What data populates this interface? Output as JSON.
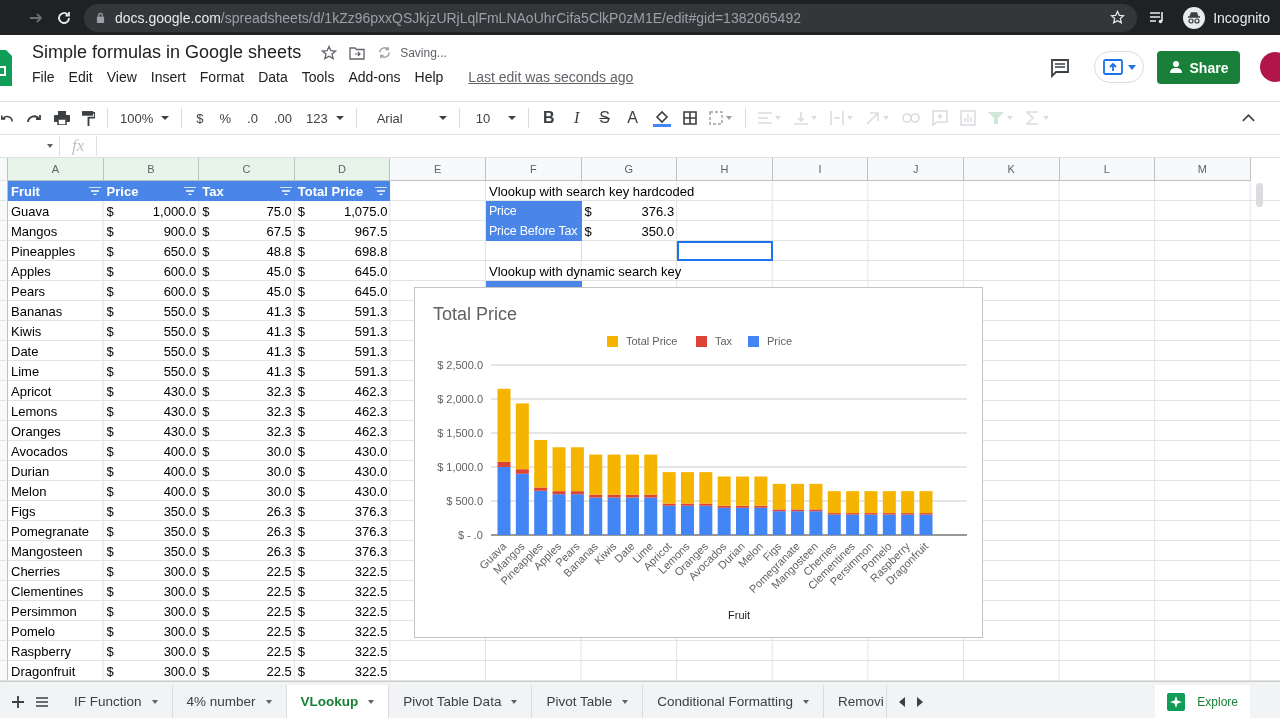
{
  "browser": {
    "url_host": "docs.google.com",
    "url_path": "/spreadsheets/d/1kZz96pxxQSJkjzURjLqlFmLNAoUhrCifa5ClkP0zM1E/edit#gid=1382065492",
    "profile": "Incognito"
  },
  "document": {
    "title": "Simple formulas in Google sheets",
    "status": "Saving...",
    "menu": [
      "File",
      "Edit",
      "View",
      "Insert",
      "Format",
      "Data",
      "Tools",
      "Add-ons",
      "Help"
    ],
    "last_edit": "Last edit was seconds ago",
    "share": "Share"
  },
  "toolbar": {
    "zoom": "100%",
    "currency": "$",
    "percent": "%",
    "decrease_decimals": ".0",
    "increase_decimals": ".00",
    "more_formats": "123",
    "font": "Arial",
    "font_size": "10",
    "text_styles": [
      "B",
      "I",
      "S",
      "A"
    ]
  },
  "formula_bar": {
    "label": "fx"
  },
  "columns": [
    "A",
    "B",
    "C",
    "D",
    "E",
    "F",
    "G",
    "H",
    "I",
    "J",
    "K",
    "L",
    "M"
  ],
  "table": {
    "headers": [
      "Fruit",
      "Price",
      "Tax",
      "Total Price"
    ],
    "rows": [
      [
        "Guava",
        [
          "$",
          "1,000.0"
        ],
        [
          "$",
          "75.0"
        ],
        [
          "$",
          "1,075.0"
        ]
      ],
      [
        "Mangos",
        [
          "$",
          "900.0"
        ],
        [
          "$",
          "67.5"
        ],
        [
          "$",
          "967.5"
        ]
      ],
      [
        "Pineapples",
        [
          "$",
          "650.0"
        ],
        [
          "$",
          "48.8"
        ],
        [
          "$",
          "698.8"
        ]
      ],
      [
        "Apples",
        [
          "$",
          "600.0"
        ],
        [
          "$",
          "45.0"
        ],
        [
          "$",
          "645.0"
        ]
      ],
      [
        "Pears",
        [
          "$",
          "600.0"
        ],
        [
          "$",
          "45.0"
        ],
        [
          "$",
          "645.0"
        ]
      ],
      [
        "Bananas",
        [
          "$",
          "550.0"
        ],
        [
          "$",
          "41.3"
        ],
        [
          "$",
          "591.3"
        ]
      ],
      [
        "Kiwis",
        [
          "$",
          "550.0"
        ],
        [
          "$",
          "41.3"
        ],
        [
          "$",
          "591.3"
        ]
      ],
      [
        "Date",
        [
          "$",
          "550.0"
        ],
        [
          "$",
          "41.3"
        ],
        [
          "$",
          "591.3"
        ]
      ],
      [
        "Lime",
        [
          "$",
          "550.0"
        ],
        [
          "$",
          "41.3"
        ],
        [
          "$",
          "591.3"
        ]
      ],
      [
        "Apricot",
        [
          "$",
          "430.0"
        ],
        [
          "$",
          "32.3"
        ],
        [
          "$",
          "462.3"
        ]
      ],
      [
        "Lemons",
        [
          "$",
          "430.0"
        ],
        [
          "$",
          "32.3"
        ],
        [
          "$",
          "462.3"
        ]
      ],
      [
        "Oranges",
        [
          "$",
          "430.0"
        ],
        [
          "$",
          "32.3"
        ],
        [
          "$",
          "462.3"
        ]
      ],
      [
        "Avocados",
        [
          "$",
          "400.0"
        ],
        [
          "$",
          "30.0"
        ],
        [
          "$",
          "430.0"
        ]
      ],
      [
        "Durian",
        [
          "$",
          "400.0"
        ],
        [
          "$",
          "30.0"
        ],
        [
          "$",
          "430.0"
        ]
      ],
      [
        "Melon",
        [
          "$",
          "400.0"
        ],
        [
          "$",
          "30.0"
        ],
        [
          "$",
          "430.0"
        ]
      ],
      [
        "Figs",
        [
          "$",
          "350.0"
        ],
        [
          "$",
          "26.3"
        ],
        [
          "$",
          "376.3"
        ]
      ],
      [
        "Pomegranate",
        [
          "$",
          "350.0"
        ],
        [
          "$",
          "26.3"
        ],
        [
          "$",
          "376.3"
        ]
      ],
      [
        "Mangosteen",
        [
          "$",
          "350.0"
        ],
        [
          "$",
          "26.3"
        ],
        [
          "$",
          "376.3"
        ]
      ],
      [
        "Cherries",
        [
          "$",
          "300.0"
        ],
        [
          "$",
          "22.5"
        ],
        [
          "$",
          "322.5"
        ]
      ],
      [
        "Clementines",
        [
          "$",
          "300.0"
        ],
        [
          "$",
          "22.5"
        ],
        [
          "$",
          "322.5"
        ]
      ],
      [
        "Persimmon",
        [
          "$",
          "300.0"
        ],
        [
          "$",
          "22.5"
        ],
        [
          "$",
          "322.5"
        ]
      ],
      [
        "Pomelo",
        [
          "$",
          "300.0"
        ],
        [
          "$",
          "22.5"
        ],
        [
          "$",
          "322.5"
        ]
      ],
      [
        "Raspberry",
        [
          "$",
          "300.0"
        ],
        [
          "$",
          "22.5"
        ],
        [
          "$",
          "322.5"
        ]
      ],
      [
        "Dragonfruit",
        [
          "$",
          "300.0"
        ],
        [
          "$",
          "22.5"
        ],
        [
          "$",
          "322.5"
        ]
      ]
    ]
  },
  "lookup": {
    "title_1": "Vlookup with search key hardcoded",
    "results": [
      {
        "label": "Price",
        "symbol": "$",
        "value": "376.3"
      },
      {
        "label": "Price Before Tax",
        "symbol": "$",
        "value": "350.0"
      }
    ],
    "blank_row": [
      {
        "selected": false
      },
      {
        "selected": false
      },
      {
        "selected": true
      }
    ],
    "title_2": "Vlookup with dynamic search key"
  },
  "chart": {
    "chart_data": {
      "type": "bar",
      "title": "Total Price",
      "xlabel": "Fruit",
      "stacked": true,
      "orientation": "vertical",
      "grid": true,
      "legend": "top",
      "categories": [
        "Guava",
        "Mangos",
        "Pineapples",
        "Apples",
        "Pears",
        "Bananas",
        "Kiwis",
        "Date",
        "Lime",
        "Apricot",
        "Lemons",
        "Oranges",
        "Avocados",
        "Durian",
        "Melon",
        "Figs",
        "Pomegranate",
        "Mangosteen",
        "Cherries",
        "Clementines",
        "Persimmon",
        "Pomelo",
        "Raspberry",
        "Dragonfruit"
      ],
      "series": [
        {
          "name": "Price",
          "color": "#4285f4",
          "values": [
            1000,
            900,
            650,
            600,
            600,
            550,
            550,
            550,
            550,
            430,
            430,
            430,
            400,
            400,
            400,
            350,
            350,
            350,
            300,
            300,
            300,
            300,
            300,
            300
          ]
        },
        {
          "name": "Tax",
          "color": "#db4437",
          "values": [
            75,
            67.5,
            48.8,
            45,
            45,
            41.3,
            41.3,
            41.3,
            41.3,
            32.3,
            32.3,
            32.3,
            30,
            30,
            30,
            26.3,
            26.3,
            26.3,
            22.5,
            22.5,
            22.5,
            22.5,
            22.5,
            22.5
          ]
        },
        {
          "name": "Total Price",
          "color": "#f4b400",
          "values": [
            1075,
            967.5,
            698.8,
            645,
            645,
            591.3,
            591.3,
            591.3,
            591.3,
            462.3,
            462.3,
            462.3,
            430,
            430,
            430,
            376.3,
            376.3,
            376.3,
            322.5,
            322.5,
            322.5,
            322.5,
            322.5,
            322.5
          ]
        }
      ],
      "ylim": [
        0,
        2500
      ],
      "yticks": [
        {
          "value": 0,
          "label": "$ -  .0"
        },
        {
          "value": 500,
          "label": "$ 500.0"
        },
        {
          "value": 1000,
          "label": "$ 1,000.0"
        },
        {
          "value": 1500,
          "label": "$ 1,500.0"
        },
        {
          "value": 2000,
          "label": "$ 2,000.0"
        },
        {
          "value": 2500,
          "label": "$ 2,500.0"
        }
      ]
    }
  },
  "sheet_tabs": [
    {
      "label": "IF Function",
      "selected": false
    },
    {
      "label": "4% number",
      "selected": false
    },
    {
      "label": "VLookup",
      "selected": true
    },
    {
      "label": "Pivot Table Data",
      "selected": false
    },
    {
      "label": "Pivot Table",
      "selected": false
    },
    {
      "label": "Conditional Formatting",
      "selected": false
    },
    {
      "label": "Removi",
      "selected": false
    }
  ],
  "explore": "Explore"
}
